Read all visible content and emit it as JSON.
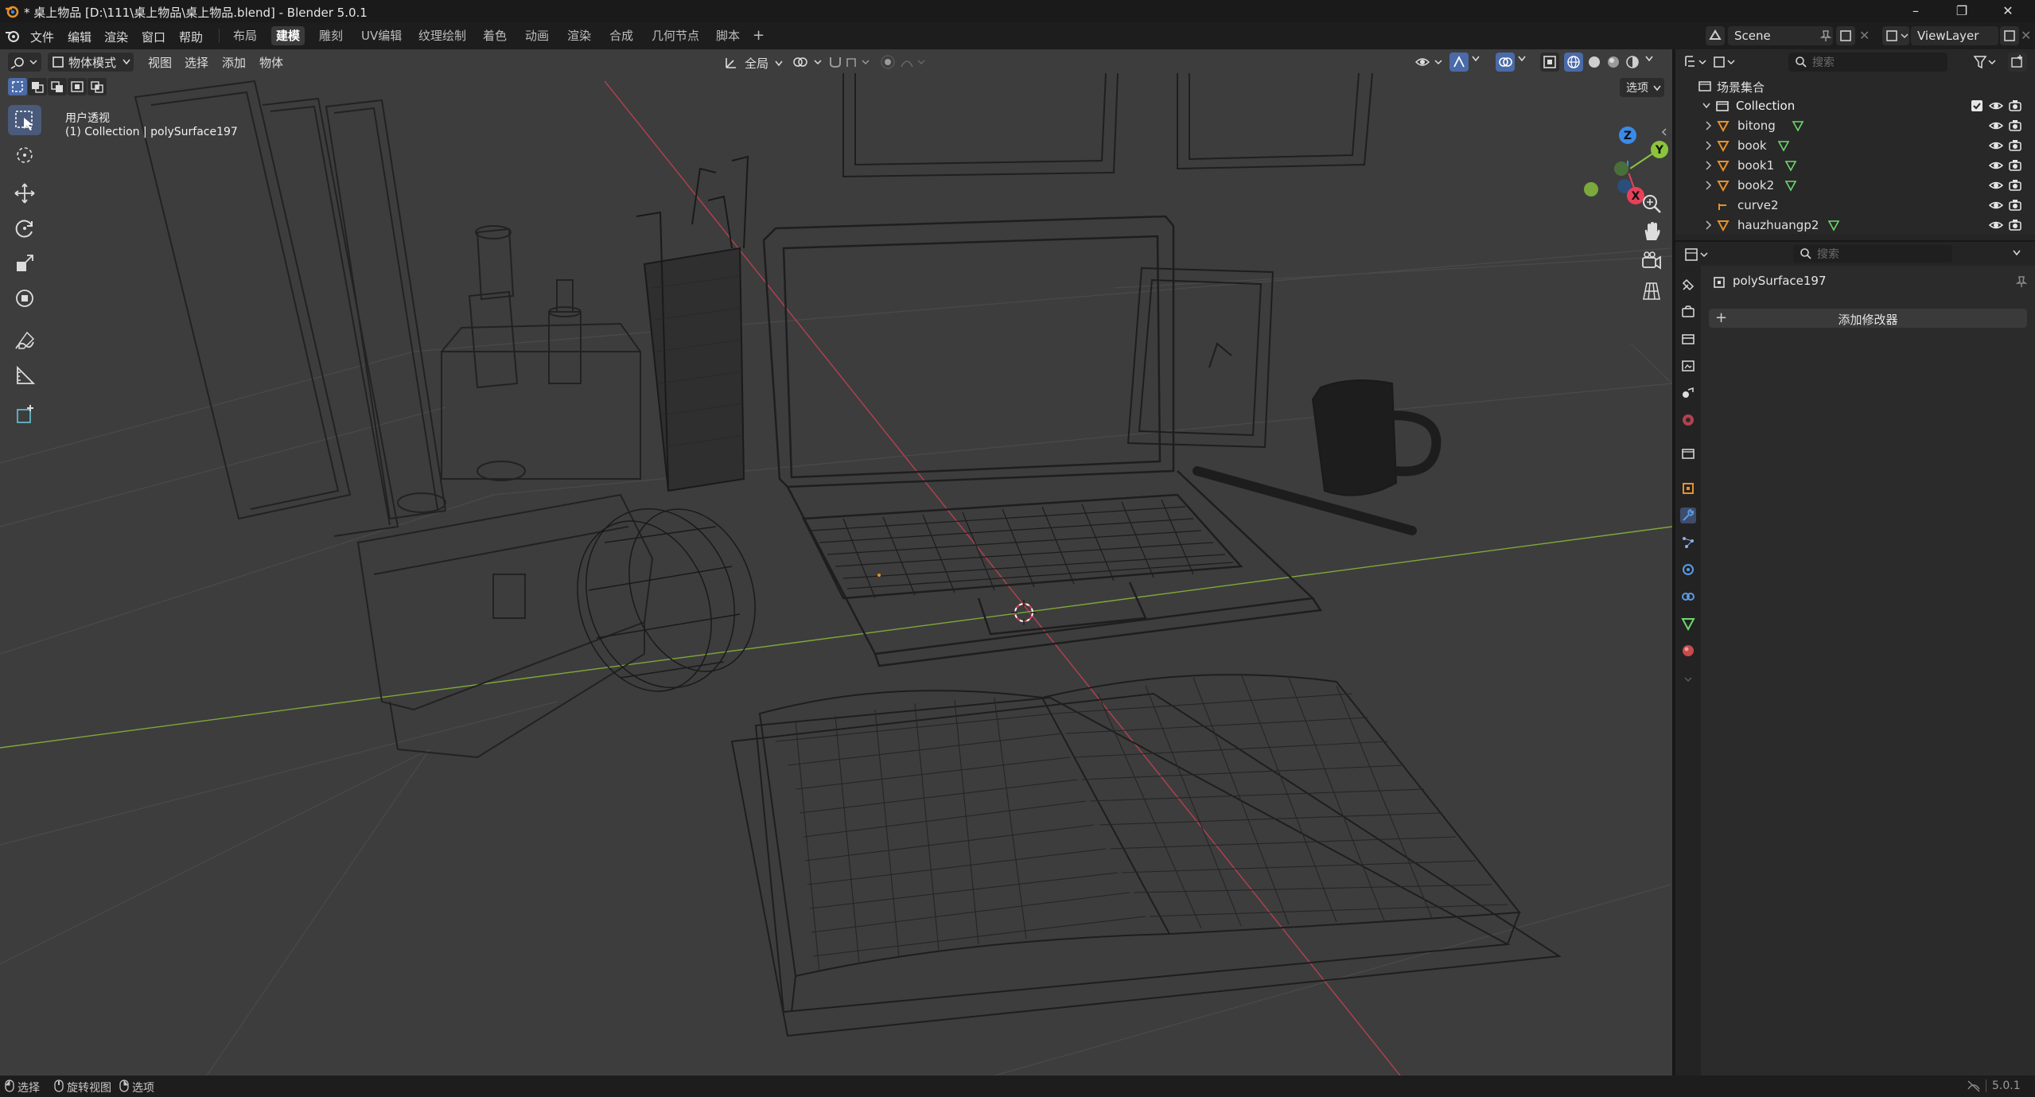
{
  "titlebar": {
    "title": "* 桌上物品 [D:\\111\\桌上物品\\桌上物品.blend] - Blender 5.0.1"
  },
  "menus": [
    "文件",
    "编辑",
    "渲染",
    "窗口",
    "帮助"
  ],
  "workspaces": [
    "布局",
    "建模",
    "雕刻",
    "UV编辑",
    "纹理绘制",
    "着色",
    "动画",
    "渲染",
    "合成",
    "几何节点",
    "脚本"
  ],
  "active_workspace": "建模",
  "scene": {
    "name": "Scene",
    "view_layer": "ViewLayer"
  },
  "viewport": {
    "mode": "物体模式",
    "menus": [
      "视图",
      "选择",
      "添加",
      "物体"
    ],
    "transform_orientation": "全局",
    "options_label": "选项",
    "view_name": "用户透视",
    "context": "(1) Collection | polySurface197",
    "gizmo_axes": [
      "Z",
      "Y",
      "X"
    ]
  },
  "outliner": {
    "search_placeholder": "搜索",
    "root": "场景集合",
    "collection": "Collection",
    "items": [
      {
        "name": "bitong",
        "type": "mesh"
      },
      {
        "name": "book",
        "type": "mesh"
      },
      {
        "name": "book1",
        "type": "mesh"
      },
      {
        "name": "book2",
        "type": "mesh"
      },
      {
        "name": "curve2",
        "type": "curve"
      },
      {
        "name": "hauzhuangp2",
        "type": "mesh"
      }
    ]
  },
  "properties": {
    "search_placeholder": "搜索",
    "object_name": "polySurface197",
    "add_modifier_label": "添加修改器",
    "active_tab": "modifier-icon"
  },
  "statusbar": {
    "items": [
      "选择",
      "旋转视图",
      "选项"
    ],
    "version": "5.0.1"
  },
  "colors": {
    "accent_blue": "#4a7acf",
    "axis_x": "#e8405a",
    "axis_y": "#8bc43c",
    "axis_z": "#3a8ae8",
    "mesh_orange": "#e8902a",
    "mesh_green": "#6dd86d"
  }
}
